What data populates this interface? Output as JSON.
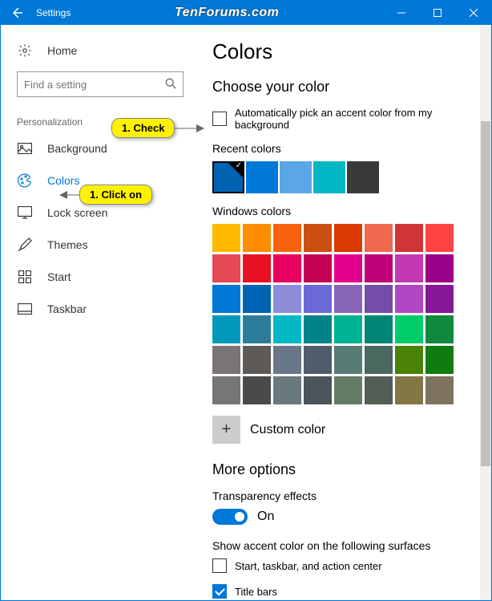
{
  "titlebar": {
    "title": "Settings",
    "watermark": "TenForums.com"
  },
  "sidebar": {
    "home_label": "Home",
    "search_placeholder": "Find a setting",
    "category_label": "Personalization",
    "items": [
      {
        "label": "Background"
      },
      {
        "label": "Colors"
      },
      {
        "label": "Lock screen"
      },
      {
        "label": "Themes"
      },
      {
        "label": "Start"
      },
      {
        "label": "Taskbar"
      }
    ]
  },
  "content": {
    "page_title": "Colors",
    "choose_heading": "Choose your color",
    "auto_pick_label": "Automatically pick an accent color from my background",
    "recent_label": "Recent colors",
    "recent_colors": [
      "#0063b1",
      "#0078d7",
      "#5aa6e6",
      "#00b7c3",
      "#3a3a3a"
    ],
    "windows_label": "Windows colors",
    "windows_colors": [
      "#ffb900",
      "#ff8c00",
      "#f7630c",
      "#ca5010",
      "#da3b01",
      "#ef6950",
      "#d13438",
      "#ff4343",
      "#e74856",
      "#e81123",
      "#ea005e",
      "#c30052",
      "#e3008c",
      "#bf0077",
      "#c239b3",
      "#9a0089",
      "#0078d7",
      "#0063b1",
      "#8e8cd8",
      "#6b69d6",
      "#8764b8",
      "#744da9",
      "#b146c2",
      "#881798",
      "#0099bc",
      "#2d7d9a",
      "#00b7c3",
      "#038387",
      "#00b294",
      "#018574",
      "#00cc6a",
      "#10893e",
      "#7a7574",
      "#5d5a58",
      "#68768a",
      "#515c6b",
      "#567c73",
      "#486860",
      "#498205",
      "#107c10",
      "#767676",
      "#4c4a48",
      "#69797e",
      "#4a5459",
      "#647c64",
      "#525e54",
      "#847545",
      "#7e735f"
    ],
    "custom_label": "Custom color",
    "more_heading": "More options",
    "transparency_label": "Transparency effects",
    "transparency_state": "On",
    "show_accent_label": "Show accent color on the following surfaces",
    "surface1_label": "Start, taskbar, and action center",
    "surface2_label": "Title bars"
  },
  "callouts": {
    "check": "1. Check",
    "click": "1. Click on"
  }
}
